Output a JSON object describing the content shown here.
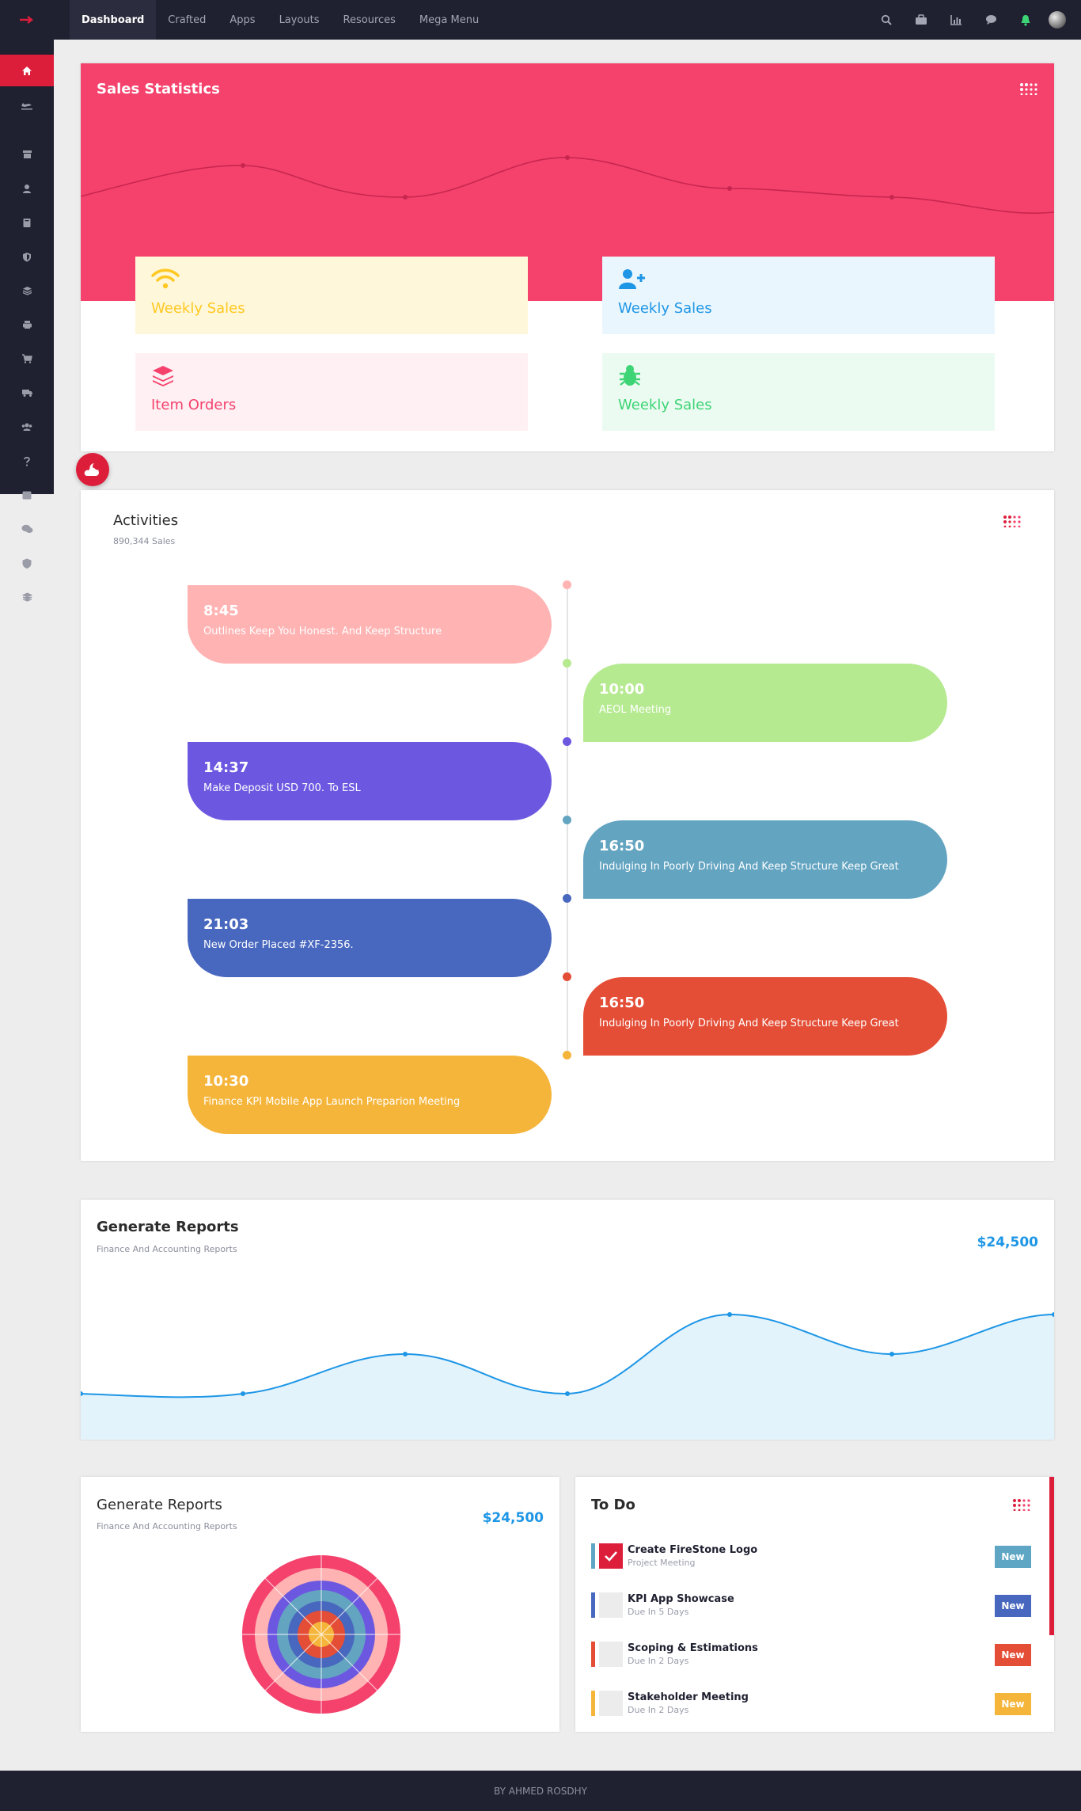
{
  "nav": {
    "links": [
      "Dashboard",
      "Crafted",
      "Apps",
      "Layouts",
      "Resources",
      "Mega Menu"
    ],
    "icons": [
      "search-icon",
      "briefcase-icon",
      "chart-icon",
      "chat-icon",
      "notification-icon",
      "user-avatar"
    ]
  },
  "sidebar": {
    "icons": [
      "home-icon",
      "plane-icon",
      "archive-icon",
      "user-icon",
      "book-icon",
      "shield-icon",
      "layers-icon",
      "print-icon",
      "cart-icon",
      "truck-icon",
      "users-icon",
      "help-icon",
      "calendar-icon",
      "comments-icon",
      "shield-icon",
      "layers-icon"
    ]
  },
  "sales": {
    "title": "Sales Statistics",
    "stats": [
      {
        "label": "Weekly Sales",
        "icon": "wifi-icon",
        "color": "#ffc822",
        "bg": "#fff7d9"
      },
      {
        "label": "Weekly Sales",
        "icon": "user-plus-icon",
        "color": "#1e96e6",
        "bg": "#eaf6fd"
      },
      {
        "label": "Item Orders",
        "icon": "layers-icon",
        "color": "#f4426d",
        "bg": "#fff0f3"
      },
      {
        "label": "Weekly Sales",
        "icon": "bug-icon",
        "color": "#3dd475",
        "bg": "#ebfbf1"
      }
    ]
  },
  "activities": {
    "title": "Activities",
    "subtitle": "890,344 Sales",
    "items": [
      {
        "time": "8:45",
        "text": "Outlines Keep You Honest. And Keep Structure",
        "color": "#ffb3b3",
        "side": "left"
      },
      {
        "time": "10:00",
        "text": "AEOL Meeting",
        "color": "#b6ea91",
        "side": "right"
      },
      {
        "time": "14:37",
        "text": "Make Deposit USD 700. To ESL",
        "color": "#6c58e0",
        "side": "left"
      },
      {
        "time": "16:50",
        "text": "Indulging In Poorly Driving And Keep Structure Keep Great",
        "color": "#63a4c1",
        "side": "right"
      },
      {
        "time": "21:03",
        "text": "New Order Placed #XF-2356.",
        "color": "#4867be",
        "side": "left"
      },
      {
        "time": "16:50",
        "text": "Indulging In Poorly Driving And Keep Structure Keep Great",
        "color": "#e44e37",
        "side": "right"
      },
      {
        "time": "10:30",
        "text": "Finance KPI Mobile App Launch Preparion Meeting",
        "color": "#f5b53a",
        "side": "left"
      }
    ]
  },
  "reports": {
    "title": "Generate Reports",
    "subtitle": "Finance And Accounting Reports",
    "amount": "$24,500"
  },
  "reports_small": {
    "title": "Generate Reports",
    "subtitle": "Finance And Accounting Reports",
    "amount": "$24,500"
  },
  "todo": {
    "title": "To Do",
    "items": [
      {
        "title": "Create FireStone Logo",
        "sub": "Project Meeting",
        "badge": "New",
        "color": "#5ea6c4",
        "checked": true
      },
      {
        "title": "KPI App Showcase",
        "sub": "Due In 5 Days",
        "badge": "New",
        "color": "#4867be",
        "checked": false
      },
      {
        "title": "Scoping & Estimations",
        "sub": "Due In 2 Days",
        "badge": "New",
        "color": "#e44e37",
        "checked": false
      },
      {
        "title": "Stakeholder Meeting",
        "sub": "Due In 2 Days",
        "badge": "New",
        "color": "#f5b53a",
        "checked": false
      }
    ]
  },
  "footer": {
    "text": "BY AHMED ROSDHY"
  },
  "colors": {
    "accent": "#dd1e3b",
    "dark": "#1f2030",
    "pink": "#f4426d",
    "blue": "#1e96e6"
  }
}
